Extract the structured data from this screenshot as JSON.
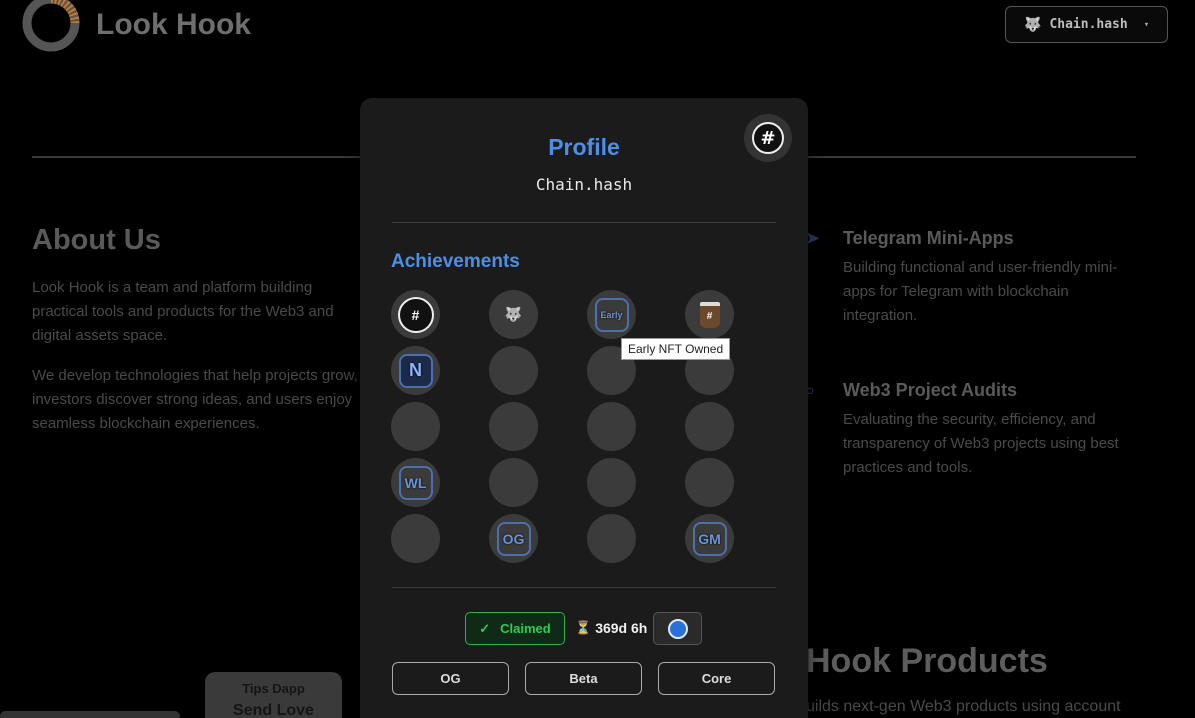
{
  "header": {
    "brand": "Look Hook",
    "wallet_label": "Chain.hash",
    "wallet_icon": "dog-icon",
    "caret": "▾"
  },
  "about": {
    "title": "About Us",
    "p1": "Look Hook is a team and platform building practical tools and products for the Web3 and digital assets space.",
    "p2": "We develop technologies that help projects grow, investors discover strong ideas, and users enjoy seamless blockchain experiences."
  },
  "services": [
    {
      "title": "Telegram Mini-Apps",
      "desc": "Building functional and user-friendly mini-apps for Telegram with blockchain integration.",
      "icon": "paper-plane-icon"
    },
    {
      "title": "Web3 Project Audits",
      "desc": "Evaluating the security, efficiency, and transparency of Web3 projects using best practices and tools.",
      "icon": "search-icon"
    }
  ],
  "products": {
    "title": "Hook Products",
    "desc": "uilds next-gen Web3 products using account"
  },
  "tips": {
    "label": "Tips Dapp",
    "send": "Send Love"
  },
  "modal": {
    "title": "Profile",
    "username": "Chain.hash",
    "achievements_title": "Achievements",
    "tooltip": "Early NFT Owned",
    "achievements": [
      {
        "icon": "hash-icon",
        "earned": true,
        "text": "#"
      },
      {
        "icon": "dog-icon",
        "earned": true,
        "text": ""
      },
      {
        "icon": "early-badge-icon",
        "earned": true,
        "text": "Early"
      },
      {
        "icon": "coffee-cup-icon",
        "earned": true,
        "text": "#"
      },
      {
        "icon": "n-badge-icon",
        "earned": true,
        "text": "N"
      },
      {
        "icon": "locked-icon",
        "earned": false,
        "text": ""
      },
      {
        "icon": "locked-icon",
        "earned": false,
        "text": ""
      },
      {
        "icon": "locked-icon",
        "earned": false,
        "text": ""
      },
      {
        "icon": "locked-icon",
        "earned": false,
        "text": ""
      },
      {
        "icon": "locked-icon",
        "earned": false,
        "text": ""
      },
      {
        "icon": "locked-icon",
        "earned": false,
        "text": ""
      },
      {
        "icon": "locked-icon",
        "earned": false,
        "text": ""
      },
      {
        "icon": "wl-badge-icon",
        "earned": true,
        "text": "WL"
      },
      {
        "icon": "locked-icon",
        "earned": false,
        "text": ""
      },
      {
        "icon": "locked-icon",
        "earned": false,
        "text": ""
      },
      {
        "icon": "locked-icon",
        "earned": false,
        "text": ""
      },
      {
        "icon": "locked-icon",
        "earned": false,
        "text": ""
      },
      {
        "icon": "og-badge-icon",
        "earned": true,
        "text": "OG"
      },
      {
        "icon": "locked-icon",
        "earned": false,
        "text": ""
      },
      {
        "icon": "gm-badge-icon",
        "earned": true,
        "text": "GM"
      }
    ],
    "claimed_label": "Claimed",
    "check": "✓",
    "timer": "369d 6h",
    "hourglass": "⏳",
    "roles": [
      "OG",
      "Beta",
      "Core"
    ]
  },
  "colors": {
    "accent": "#4d8fe6",
    "success": "#2fcc55"
  }
}
